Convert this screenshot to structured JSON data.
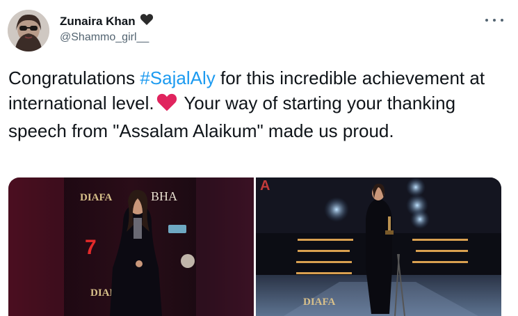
{
  "author": {
    "display_name": "Zunaira Khan",
    "handle": "@Shammo_girl__",
    "badge_emoji": "black-heart"
  },
  "tweet": {
    "text_before": "Congratulations ",
    "hashtag": "#SajalAly",
    "text_middle": " for this incredible achievement at international level.",
    "text_after": " Your way of starting your thanking speech from \"Assalam Alaikum\" made us proud."
  },
  "media": {
    "image1_logo": "DIAFA",
    "image1_sign": "BHA",
    "image2_logo": "DIAFA"
  },
  "colors": {
    "link": "#1d9bf0",
    "text": "#0f1419",
    "secondary": "#536471",
    "heart": "#e0245e"
  },
  "icons": {
    "more": "more-options-icon",
    "red_heart": "red-heart-icon",
    "black_heart": "black-heart-icon"
  }
}
